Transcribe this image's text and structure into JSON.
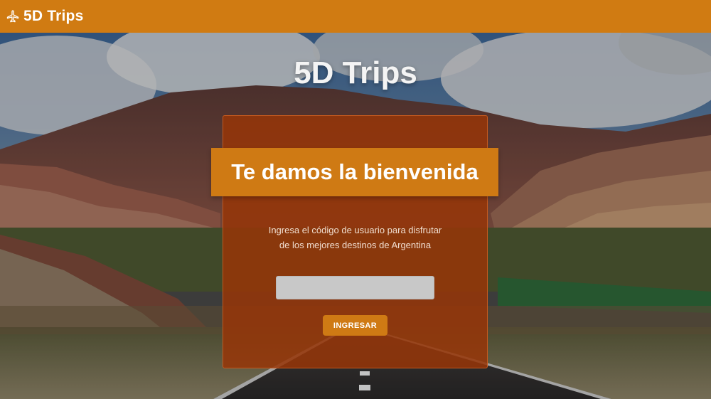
{
  "navbar": {
    "brand_name": "5D Trips",
    "brand_icon": "airplane-icon",
    "background_color": "#d07b12"
  },
  "hero": {
    "title": "5D Trips"
  },
  "login_card": {
    "heading": "Te damos la bienvenida",
    "description_line1": "Ingresa el código de usuario para disfrutar",
    "description_line2": "de los mejores destinos de Argentina",
    "input_value": "",
    "input_placeholder": "",
    "submit_label": "INGRESAR",
    "card_color": "#963608",
    "accent_color": "#cf7a14"
  }
}
